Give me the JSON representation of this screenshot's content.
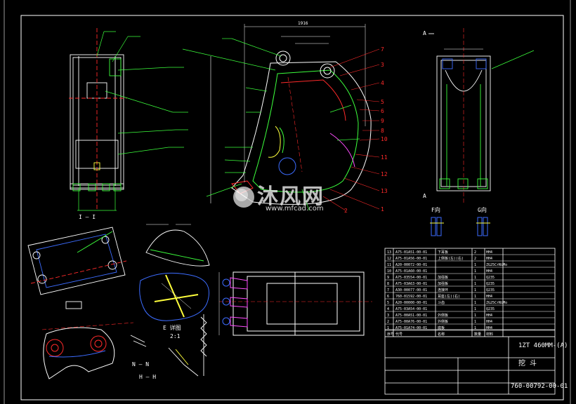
{
  "drawing": {
    "title_block": {
      "name": "1ZT 460MM-(A)",
      "code": "760-00792-00-01",
      "product": "挖  斗"
    },
    "bom_rows": [
      {
        "no": "13",
        "code": "A75-01A51-00-01",
        "name": "下耳板",
        "qty": "2",
        "mat": "HH4"
      },
      {
        "no": "12",
        "code": "A75-01A56-00-01",
        "name": "上侧板(左)(右)",
        "qty": "2",
        "mat": "HH4"
      },
      {
        "no": "11",
        "code": "A20-00072-00-01",
        "name": "",
        "qty": "1",
        "mat": "ZG25CrNiMo"
      },
      {
        "no": "10",
        "code": "A75-01A60-00-01",
        "name": "",
        "qty": "1",
        "mat": "HH4"
      },
      {
        "no": "9",
        "code": "A75-03554-00-01",
        "name": "加强板",
        "qty": "1",
        "mat": "Q235"
      },
      {
        "no": "8",
        "code": "A75-03A63-00-01",
        "name": "加强板",
        "qty": "1",
        "mat": "Q235"
      },
      {
        "no": "7",
        "code": "A30-00077-00-01",
        "name": "连接环",
        "qty": "1",
        "mat": "Q235"
      },
      {
        "no": "6",
        "code": "760-01592-00-01",
        "name": "耳座(左)(右)",
        "qty": "1",
        "mat": "HH4"
      },
      {
        "no": "5",
        "code": "A20-00000-00-01",
        "name": "斗齿",
        "qty": "1",
        "mat": "ZG25CrNiMo"
      },
      {
        "no": "4",
        "code": "A75-03A54-00-01",
        "name": "",
        "qty": "1",
        "mat": "Q235"
      },
      {
        "no": "3",
        "code": "A75-00A51-00-01",
        "name": "外侧板",
        "qty": "1",
        "mat": "HH4"
      },
      {
        "no": "2",
        "code": "A75-00A76-00-01",
        "name": "外侧板",
        "qty": "1",
        "mat": "HH4"
      },
      {
        "no": "1",
        "code": "A75-01A74-00-01",
        "name": "底板",
        "qty": "1",
        "mat": "HH4"
      }
    ],
    "header_labels": [
      "序号",
      "代号",
      "名称",
      "数量",
      "材料"
    ],
    "view_labels": {
      "section_a_top": "A",
      "section_a_bottom": "A",
      "view_f": "F向",
      "view_g": "G向",
      "detail_e": "E 详图",
      "detail_scale": "2:1",
      "sec_nn": "N — N",
      "sec_hh": "H — H",
      "sec_ii": "I — I",
      "dim_top": "1916"
    },
    "balloons": [
      "7",
      "3",
      "4",
      "5",
      "6",
      "9",
      "8",
      "10",
      "11",
      "12",
      "13",
      "1",
      "2"
    ]
  },
  "watermark": {
    "text": "沐风网",
    "url": "www.mfcad.com"
  },
  "colors": {
    "bg": "#000000",
    "white": "#ffffff",
    "green": "#3cff3c",
    "red": "#ff2a2a",
    "blue": "#3c6cff",
    "yellow": "#ffff3c",
    "cyan": "#3cffff",
    "magenta": "#ff4cff"
  }
}
